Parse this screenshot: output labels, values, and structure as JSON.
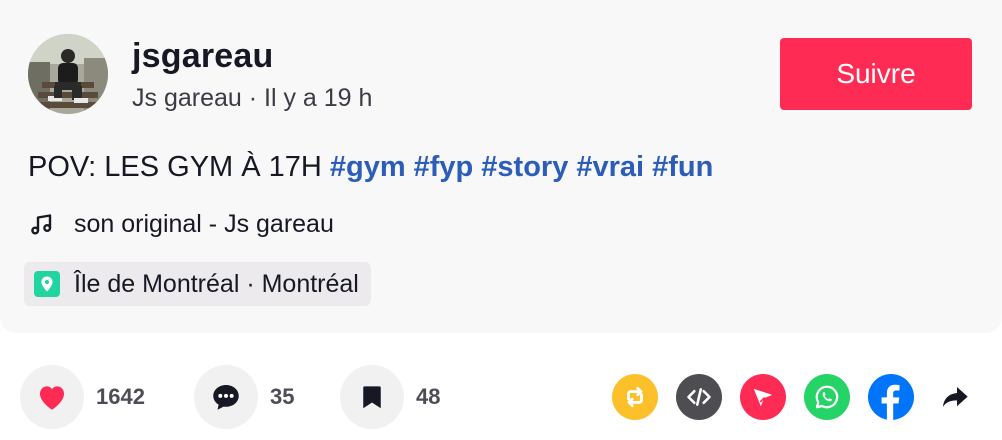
{
  "author": {
    "username": "jsgareau",
    "display_line": "Js gareau · Il y a 19 h"
  },
  "follow_label": "Suivre",
  "description": {
    "text": "POV: LES GYM À 17H",
    "hashtags": [
      "#gym",
      "#fyp",
      "#story",
      "#vrai",
      "#fun"
    ]
  },
  "music": "son original - Js gareau",
  "location": "Île de Montréal · Montréal",
  "stats": {
    "likes": "1642",
    "comments": "35",
    "saves": "48"
  },
  "colors": {
    "brand": "#fe2c55",
    "hashtag": "#2b5db9",
    "repost": "#fcc02a",
    "embed": "#4e4e52",
    "send": "#fe2c55",
    "whatsapp": "#25d366",
    "facebook": "#0075fa"
  },
  "share_icons": [
    "repost-icon",
    "embed-icon",
    "send-to-friends-icon",
    "whatsapp-icon",
    "facebook-icon",
    "share-arrow-icon"
  ]
}
